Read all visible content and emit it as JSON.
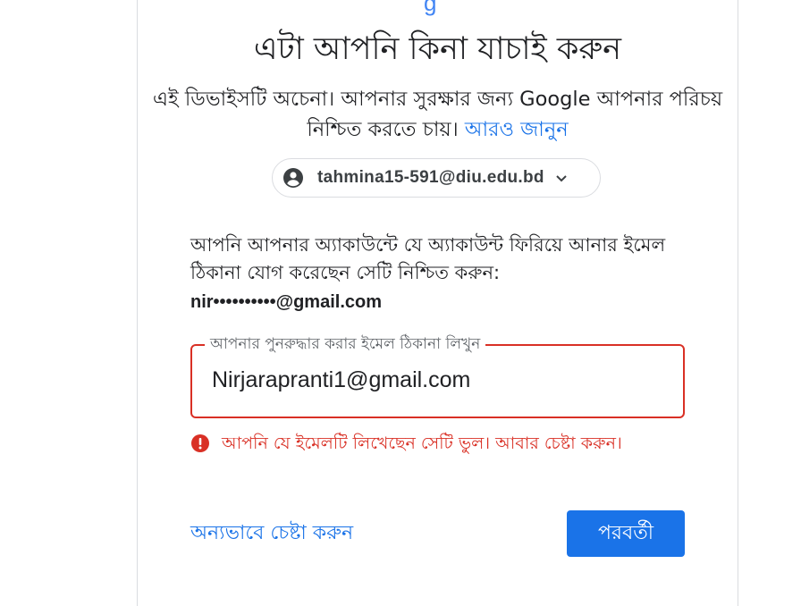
{
  "header": {
    "logo_fragment": "g"
  },
  "title": "এটা আপনি কিনা যাচাই করুন",
  "subtitle": {
    "text": "এই ডিভাইসটি অচেনা। আপনার সুরক্ষার জন্য Google আপনার পরিচয় নিশ্চিত করতে চায়।",
    "link_label": "আরও জানুন"
  },
  "account": {
    "email": "tahmina15-591@diu.edu.bd",
    "avatar_icon": "account-circle-icon",
    "dropdown_icon": "chevron-down-icon"
  },
  "instruction": "আপনি আপনার অ্যাকাউন্টে যে অ্যাকাউন্ট ফিরিয়ে আনার ইমেল ঠিকানা যোগ করেছেন সেটি নিশ্চিত করুন:",
  "masked_recovery_email": "nir••••••••••@gmail.com",
  "recovery_field": {
    "label": "আপনার পুনরুদ্ধার করার ইমেল ঠিকানা লিখুন",
    "value": "Nirjarapranti1@gmail.com"
  },
  "error": {
    "icon": "error-icon",
    "message": "আপনি যে ইমেলটি লিখেছেন সেটি ভুল। আবার চেষ্টা করুন।"
  },
  "actions": {
    "try_another_label": "অন্যভাবে চেষ্টা করুন",
    "next_label": "পরবর্তী"
  },
  "colors": {
    "accent": "#1a73e8",
    "error": "#d93025",
    "text": "#202124",
    "border": "#dadce0"
  }
}
